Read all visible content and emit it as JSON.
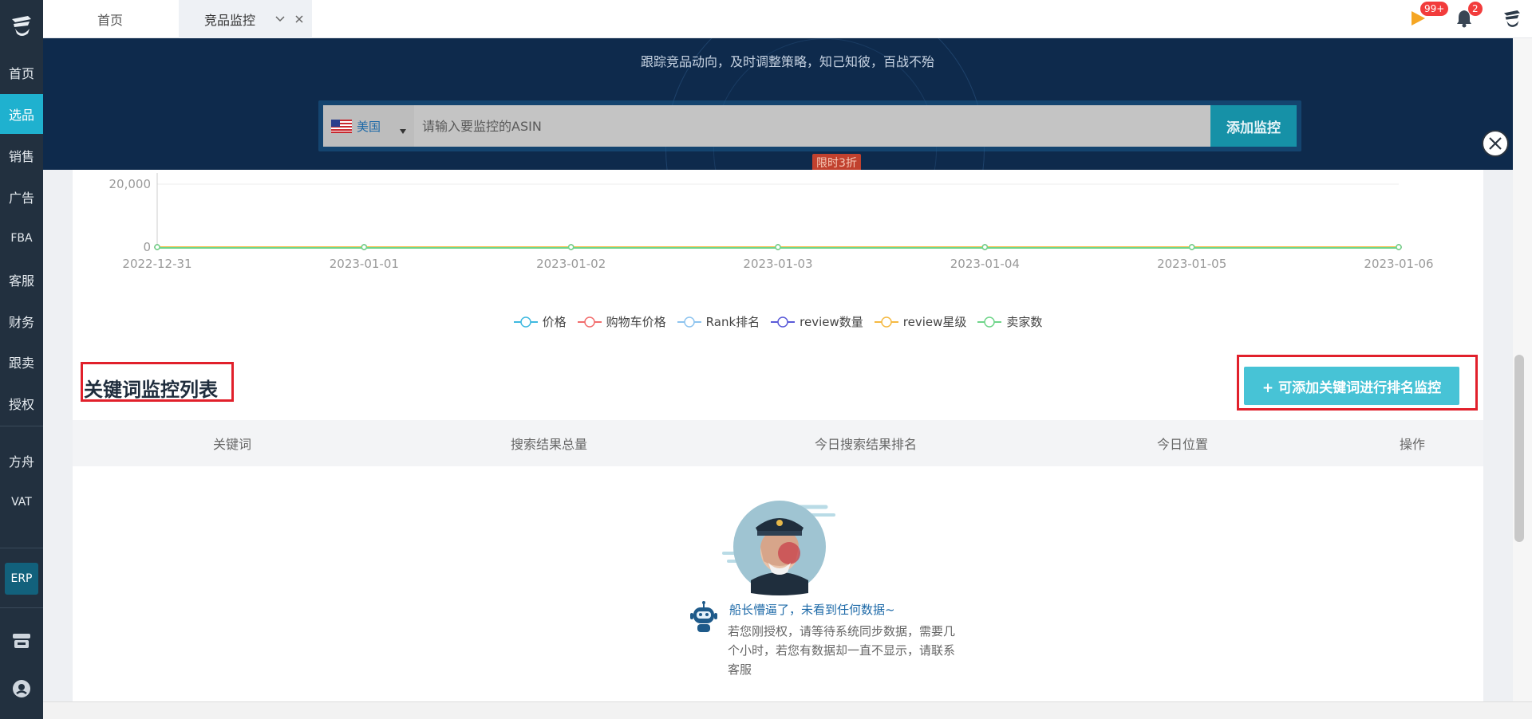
{
  "sidebar": {
    "items": [
      {
        "label": "首页"
      },
      {
        "label": "选品"
      },
      {
        "label": "销售"
      },
      {
        "label": "广告"
      },
      {
        "label": "FBA"
      },
      {
        "label": "客服"
      },
      {
        "label": "财务"
      },
      {
        "label": "跟卖"
      },
      {
        "label": "授权"
      },
      {
        "label": "方舟"
      },
      {
        "label": "VAT"
      }
    ],
    "erp_label": "ERP"
  },
  "tabs": {
    "home": "首页",
    "active": "竞品监控"
  },
  "topbar": {
    "flag_badge": "99+",
    "bell_badge": "2"
  },
  "banner": {
    "subtitle": "跟踪竞品动向，及时调整策略，知己知彼，百战不殆",
    "country": "美国",
    "search_placeholder": "请输入要监控的ASIN",
    "add_button": "添加监控",
    "promo": "限时3折"
  },
  "chart_data": {
    "type": "line",
    "x": [
      "2022-12-31",
      "2023-01-01",
      "2023-01-02",
      "2023-01-03",
      "2023-01-04",
      "2023-01-05",
      "2023-01-06"
    ],
    "y_ticks": [
      "20,000",
      "0"
    ],
    "series": [
      {
        "name": "价格",
        "color": "#3fb9e0",
        "values": [
          0,
          0,
          0,
          0,
          0,
          0,
          0
        ]
      },
      {
        "name": "购物车价格",
        "color": "#f26d6d",
        "values": [
          0,
          0,
          0,
          0,
          0,
          0,
          0
        ]
      },
      {
        "name": "Rank排名",
        "color": "#8ec4ef",
        "values": [
          0,
          0,
          0,
          0,
          0,
          0,
          0
        ]
      },
      {
        "name": "review数量",
        "color": "#5a5ad8",
        "values": [
          0,
          0,
          0,
          0,
          0,
          0,
          0
        ]
      },
      {
        "name": "review星级",
        "color": "#f5b942",
        "values": [
          0,
          0,
          0,
          0,
          0,
          0,
          0
        ]
      },
      {
        "name": "卖家数",
        "color": "#6fd58a",
        "values": [
          0,
          0,
          0,
          0,
          0,
          0,
          0
        ]
      }
    ]
  },
  "keyword_section": {
    "title": "关键词监控列表",
    "add_button": "+ 可添加关键词进行排名监控",
    "columns": [
      "关键词",
      "搜索结果总量",
      "今日搜索结果排名",
      "今日位置",
      "操作"
    ]
  },
  "empty_state": {
    "title": "船长懵逼了，未看到任何数据~",
    "description": "若您刚授权，请等待系统同步数据，需要几个小时，若您有数据却一直不显示，请联系客服"
  }
}
